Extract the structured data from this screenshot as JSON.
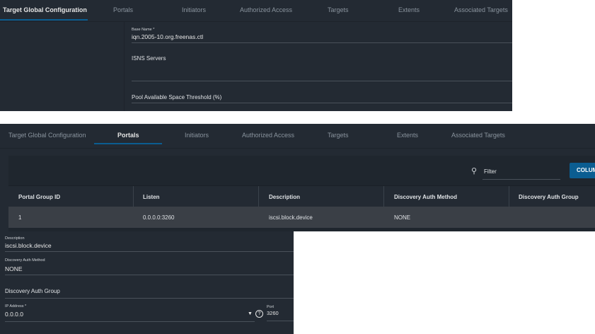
{
  "tabs": [
    "Target Global Configuration",
    "Portals",
    "Initiators",
    "Authorized Access",
    "Targets",
    "Extents",
    "Associated Targets"
  ],
  "global_config": {
    "base_name_label": "Base Name *",
    "base_name_value": "iqn.2005-10.org.freenas.ctl",
    "isns_label": "ISNS Servers",
    "pool_threshold_label": "Pool Available Space Threshold (%)"
  },
  "portals": {
    "filter_placeholder": "Filter",
    "columns_button": "COLUMNS",
    "headers": [
      "Portal Group ID",
      "Listen",
      "Description",
      "Discovery Auth Method",
      "Discovery Auth Group"
    ],
    "rows": [
      [
        "1",
        "0.0.0.0:3260",
        "iscsi.block.device",
        "NONE",
        ""
      ]
    ]
  },
  "portal_form": {
    "description_label": "Description",
    "description_value": "iscsi.block.device",
    "auth_method_label": "Discovery Auth Method",
    "auth_method_value": "NONE",
    "auth_group_label": "Discovery Auth Group",
    "ip_label": "IP Address *",
    "ip_value": "0.0.0.0",
    "port_label": "Port",
    "port_value": "3260"
  }
}
